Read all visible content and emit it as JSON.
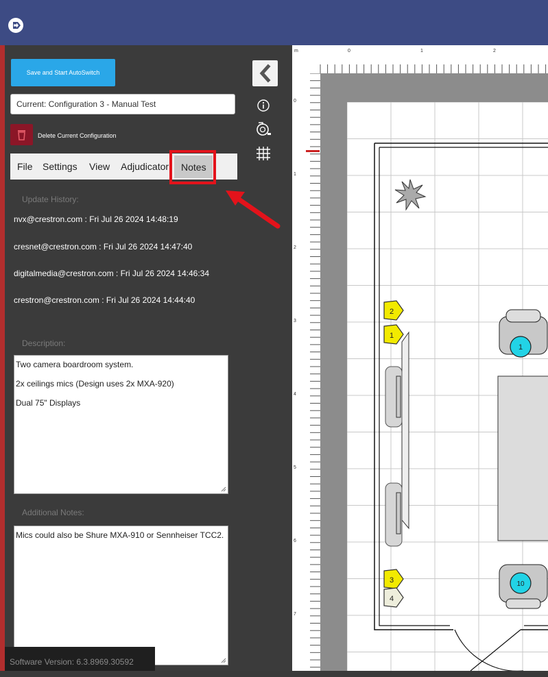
{
  "header": {
    "exit_icon": "exit-icon"
  },
  "sidebar": {
    "save_label": "Save and Start AutoSwitch",
    "current_config": "Current: Configuration 3 - Manual Test",
    "delete_label": "Delete Current Configuration",
    "menu": [
      "File",
      "Settings",
      "View",
      "Adjudicator",
      "Notes"
    ],
    "update_history_label": "Update History:",
    "history": [
      "nvx@crestron.com : Fri Jul 26 2024 14:48:19",
      "cresnet@crestron.com : Fri Jul 26 2024 14:47:40",
      "digitalmedia@crestron.com : Fri Jul 26 2024 14:46:34",
      "crestron@crestron.com : Fri Jul 26 2024 14:44:40"
    ],
    "description_label": "Description:",
    "description_lines": [
      "Two camera boardroom system.",
      "2x ceilings mics (Design uses 2x MXA-920)",
      "Dual 75\" Displays"
    ],
    "additional_label": "Additional Notes:",
    "additional_text": "Mics could also be Shure MXA-910 or Sennheiser TCC2.",
    "version": "Software Version: 6.3.8969.30592"
  },
  "canvas": {
    "ruler_unit": "m",
    "ruler_top": [
      "0",
      "1",
      "2"
    ],
    "ruler_left": [
      "0",
      "1",
      "2",
      "3",
      "4",
      "5",
      "6",
      "7"
    ],
    "markers": [
      "2",
      "1",
      "3",
      "4"
    ],
    "seats": [
      "1",
      "10"
    ]
  },
  "colors": {
    "accent": "#2aa7e8",
    "header": "#3d4b84",
    "danger": "#8b1627",
    "highlight": "#e3131b",
    "marker": "#f2ea00",
    "seat": "#22d3e6"
  }
}
